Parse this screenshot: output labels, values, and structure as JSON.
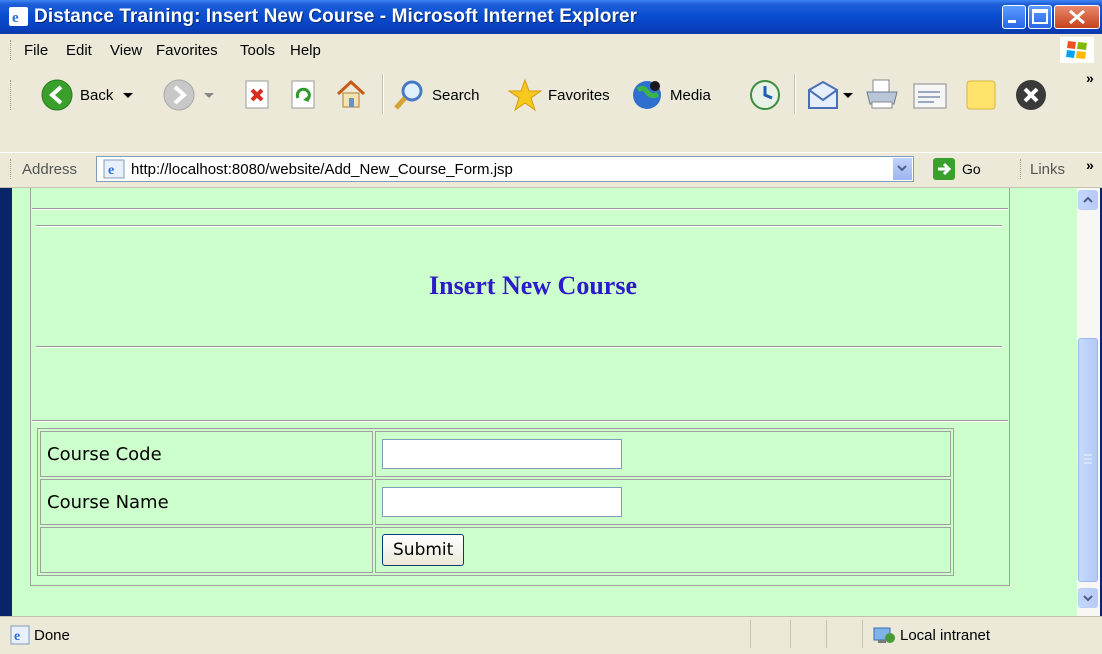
{
  "window": {
    "title": "Distance Training: Insert New Course - Microsoft Internet Explorer"
  },
  "menu": [
    "File",
    "Edit",
    "View",
    "Favorites",
    "Tools",
    "Help"
  ],
  "toolbar": {
    "back_label": "Back",
    "search_label": "Search",
    "favorites_label": "Favorites",
    "media_label": "Media"
  },
  "address": {
    "label": "Address",
    "url": "http://localhost:8080/website/Add_New_Course_Form.jsp",
    "go_label": "Go",
    "links_label": "Links"
  },
  "page": {
    "heading": "Insert New Course",
    "form": {
      "code_label": "Course Code",
      "code_value": "",
      "name_label": "Course Name",
      "name_value": "",
      "submit_label": "Submit"
    }
  },
  "status": {
    "text": "Done",
    "zone": "Local intranet"
  },
  "colors": {
    "page_background": "#ccffcc",
    "heading": "#2b1bc8",
    "title_bar": "#0a4ed1"
  }
}
